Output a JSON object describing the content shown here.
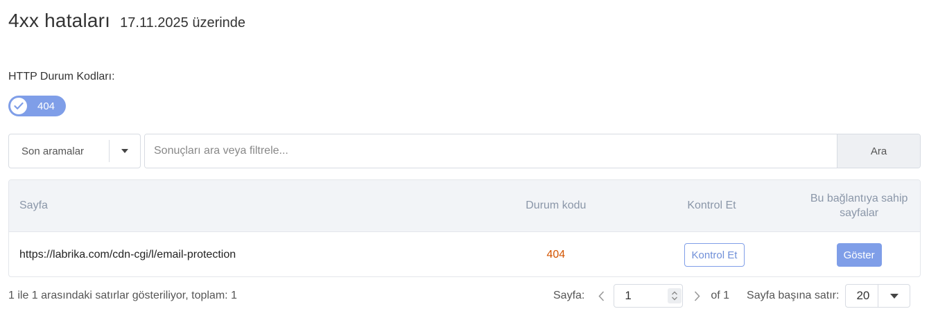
{
  "header": {
    "title": "4xx hataları",
    "subtitle": "17.11.2025 üzerinde"
  },
  "filters": {
    "label": "HTTP Durum Kodları:",
    "chips": [
      {
        "label": "404",
        "checked": true
      }
    ]
  },
  "search": {
    "saved_searches_label": "Son aramalar",
    "placeholder": "Sonuçları ara veya filtrele...",
    "value": "",
    "button_label": "Ara"
  },
  "table": {
    "columns": {
      "page": "Sayfa",
      "status": "Durum kodu",
      "check": "Kontrol Et",
      "linking_pages": "Bu bağlantıya sahip sayfalar"
    },
    "rows": [
      {
        "url": "https://labrika.com/cdn-cgi/l/email-protection",
        "status": "404",
        "check_button": "Kontrol Et",
        "show_button": "Göster"
      }
    ]
  },
  "footer": {
    "summary": "1 ile 1 arasındaki satırlar gösteriliyor, toplam: 1",
    "page_label": "Sayfa:",
    "current_page": "1",
    "of_pages": "of 1",
    "rows_per_page_label": "Sayfa başına satır:",
    "rows_per_page": "20"
  },
  "colors": {
    "accent": "#7f9ee8",
    "status_error": "#d35400",
    "header_bg": "#f2f4f7"
  },
  "icons": {
    "chip": "check-icon",
    "select": "caret-down-icon",
    "prev": "chevron-left-icon",
    "next": "chevron-right-icon",
    "spinner": "spinner-up-down-icon"
  }
}
